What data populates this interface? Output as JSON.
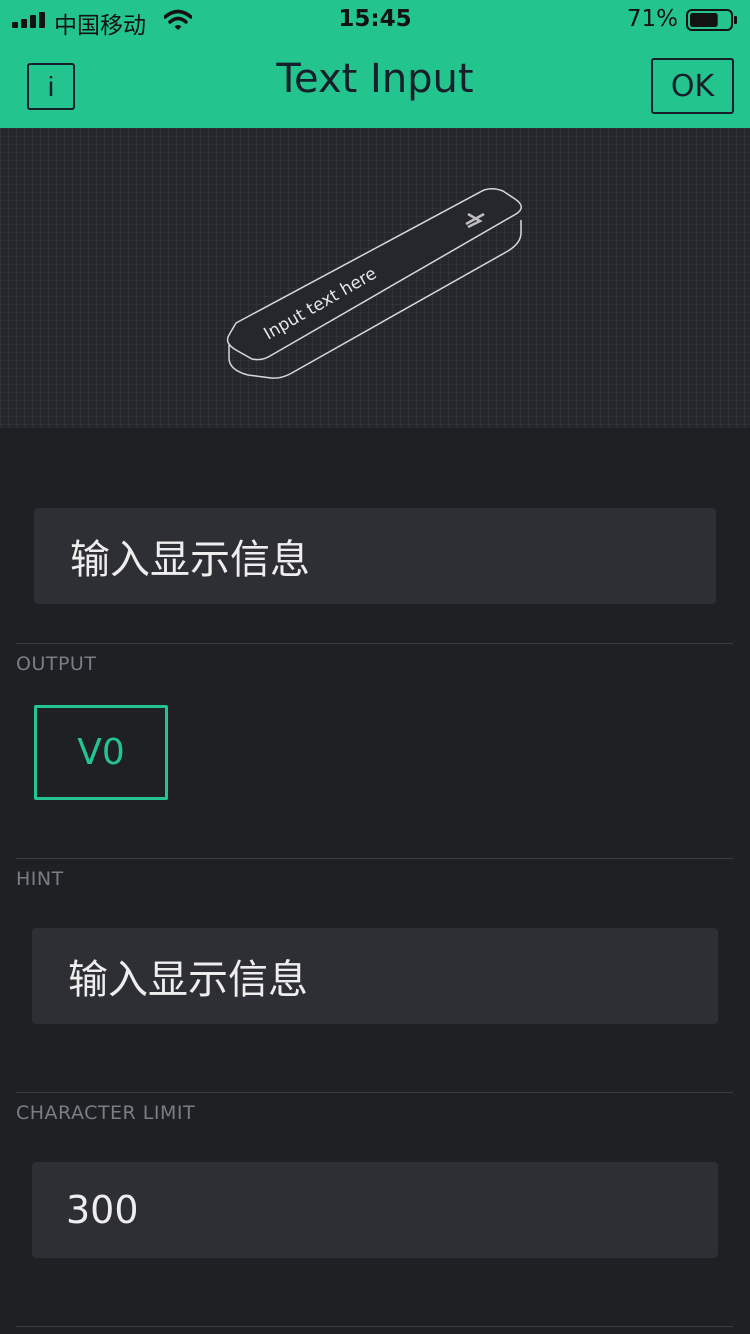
{
  "status_bar": {
    "carrier": "中国移动",
    "time": "15:45",
    "battery_percent": "71%",
    "battery_level": 0.71,
    "icons": [
      "signal-icon",
      "wifi-icon",
      "battery-icon"
    ]
  },
  "nav": {
    "info_label": "i",
    "title": "Text Input",
    "ok_label": "OK"
  },
  "preview": {
    "placeholder": "Input text here",
    "icon": "enter-arrow-icon"
  },
  "settings": {
    "widget_title": "输入显示信息",
    "output_label": "OUTPUT",
    "output_pin": "V0",
    "hint_label": "HINT",
    "hint_value": "输入显示信息",
    "limit_label": "CHARACTER LIMIT",
    "limit_value": "300"
  },
  "colors": {
    "accent": "#23c48e",
    "background": "#1f2024",
    "field": "#2d2f35",
    "label": "#7a7d85"
  }
}
